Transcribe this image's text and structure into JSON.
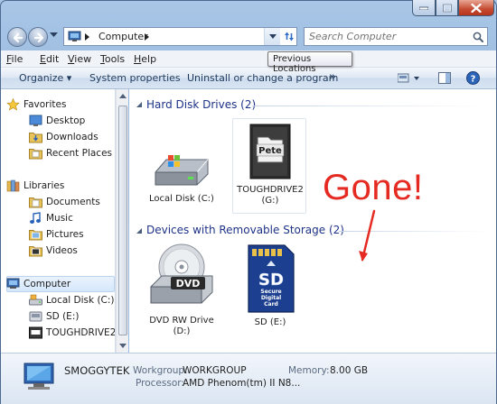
{
  "window": {
    "colors": {
      "accent": "#1e3287",
      "annotation": "#e52a22",
      "close": "#c44b31"
    }
  },
  "address": {
    "path": "Computer",
    "computer_icon": "computer-icon"
  },
  "search": {
    "placeholder": "Search Computer"
  },
  "tooltip": {
    "text": "Previous Locations"
  },
  "menu": {
    "items": [
      {
        "key": "F",
        "rest": "ile"
      },
      {
        "key": "E",
        "rest": "dit"
      },
      {
        "key": "V",
        "rest": "iew"
      },
      {
        "key": "T",
        "rest": "ools"
      },
      {
        "key": "H",
        "rest": "elp"
      }
    ]
  },
  "command_bar": {
    "organize": "Organize",
    "system_properties": "System properties",
    "uninstall": "Uninstall or change a program",
    "more": "»"
  },
  "nav": {
    "favorites": "Favorites",
    "desktop": "Desktop",
    "downloads": "Downloads",
    "recent_places": "Recent Places",
    "libraries": "Libraries",
    "documents": "Documents",
    "music": "Music",
    "pictures": "Pictures",
    "videos": "Videos",
    "computer": "Computer",
    "local_disk": "Local Disk (C:)",
    "sd": "SD (E:)",
    "toughdrive": "TOUGHDRIVE2 (G:)"
  },
  "groups": {
    "hard_disks": {
      "header": "Hard Disk Drives (2)",
      "items": [
        {
          "line1": "Local Disk (C:)",
          "line2": ""
        },
        {
          "line1": "TOUGHDRIVE2",
          "line2": "(G:)",
          "badge": "Pete"
        }
      ]
    },
    "removable": {
      "header": "Devices with Removable Storage (2)",
      "items": [
        {
          "line1": "DVD RW Drive",
          "line2": "(D:)",
          "badge": "DVD"
        },
        {
          "line1": "SD (E:)",
          "line2": "",
          "badge": "SD",
          "badge_sub1": "Secure",
          "badge_sub2": "Digital",
          "badge_sub3": "Card"
        }
      ]
    }
  },
  "annotation": {
    "text": "Gone!"
  },
  "details": {
    "name": "SMOGGYTEK",
    "workgroup_label": "Workgroup:",
    "workgroup_value": "WORKGROUP",
    "memory_label": "Memory:",
    "memory_value": "8.00 GB",
    "processor_label": "Processor:",
    "processor_value": "AMD Phenom(tm) II N8..."
  }
}
